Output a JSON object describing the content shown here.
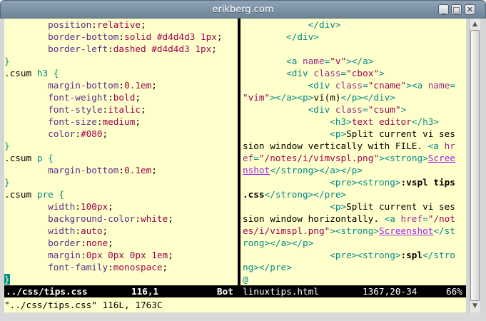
{
  "window": {
    "title": "erikberg.com",
    "buttons": {
      "minimize": "_",
      "maximize": "□",
      "close": "✕"
    }
  },
  "left_pane": {
    "lines": [
      [
        {
          "t": "        "
        },
        {
          "t": "position",
          "c": "prop"
        },
        {
          "t": ":"
        },
        {
          "t": "relative",
          "c": "val"
        },
        {
          "t": ";"
        }
      ],
      [
        {
          "t": "        "
        },
        {
          "t": "border-bottom",
          "c": "prop"
        },
        {
          "t": ":"
        },
        {
          "t": "solid #d4d4d3 1px",
          "c": "val"
        },
        {
          "t": ";"
        }
      ],
      [
        {
          "t": "        "
        },
        {
          "t": "border-left",
          "c": "prop"
        },
        {
          "t": ":"
        },
        {
          "t": "dashed #d4d4d3 1px",
          "c": "val"
        },
        {
          "t": ";"
        }
      ],
      [
        {
          "t": "}",
          "c": "brace"
        }
      ],
      [
        {
          "t": ".csum "
        },
        {
          "t": "h3",
          "c": "sel"
        },
        {
          "t": " "
        },
        {
          "t": "{",
          "c": "brace"
        }
      ],
      [
        {
          "t": "        "
        },
        {
          "t": "margin-bottom",
          "c": "prop"
        },
        {
          "t": ":"
        },
        {
          "t": "0.1em",
          "c": "val"
        },
        {
          "t": ";"
        }
      ],
      [
        {
          "t": "        "
        },
        {
          "t": "font-weight",
          "c": "prop"
        },
        {
          "t": ":"
        },
        {
          "t": "bold",
          "c": "val"
        },
        {
          "t": ";"
        }
      ],
      [
        {
          "t": "        "
        },
        {
          "t": "font-style",
          "c": "prop"
        },
        {
          "t": ":"
        },
        {
          "t": "italic",
          "c": "val"
        },
        {
          "t": ";"
        }
      ],
      [
        {
          "t": "        "
        },
        {
          "t": "font-size",
          "c": "prop"
        },
        {
          "t": ":"
        },
        {
          "t": "medium",
          "c": "val"
        },
        {
          "t": ";"
        }
      ],
      [
        {
          "t": "        "
        },
        {
          "t": "color",
          "c": "prop"
        },
        {
          "t": ":"
        },
        {
          "t": "#080",
          "c": "val"
        },
        {
          "t": ";"
        }
      ],
      [
        {
          "t": "}",
          "c": "brace"
        }
      ],
      [
        {
          "t": ".csum "
        },
        {
          "t": "p",
          "c": "sel"
        },
        {
          "t": " "
        },
        {
          "t": "{",
          "c": "brace"
        }
      ],
      [
        {
          "t": "        "
        },
        {
          "t": "margin-bottom",
          "c": "prop"
        },
        {
          "t": ":"
        },
        {
          "t": "0.1em",
          "c": "val"
        },
        {
          "t": ";"
        }
      ],
      [
        {
          "t": "}",
          "c": "brace"
        }
      ],
      [
        {
          "t": ".csum "
        },
        {
          "t": "pre",
          "c": "sel"
        },
        {
          "t": " "
        },
        {
          "t": "{",
          "c": "brace"
        }
      ],
      [
        {
          "t": "        "
        },
        {
          "t": "width",
          "c": "prop"
        },
        {
          "t": ":"
        },
        {
          "t": "100px",
          "c": "val"
        },
        {
          "t": ";"
        }
      ],
      [
        {
          "t": "        "
        },
        {
          "t": "background-color",
          "c": "prop"
        },
        {
          "t": ":"
        },
        {
          "t": "white",
          "c": "val"
        },
        {
          "t": ";"
        }
      ],
      [
        {
          "t": "        "
        },
        {
          "t": "width",
          "c": "prop"
        },
        {
          "t": ":"
        },
        {
          "t": "auto",
          "c": "val"
        },
        {
          "t": ";"
        }
      ],
      [
        {
          "t": "        "
        },
        {
          "t": "border",
          "c": "prop"
        },
        {
          "t": ":"
        },
        {
          "t": "none",
          "c": "val"
        },
        {
          "t": ";"
        }
      ],
      [
        {
          "t": "        "
        },
        {
          "t": "margin",
          "c": "prop"
        },
        {
          "t": ":"
        },
        {
          "t": "0px 0px 0px 1em",
          "c": "val"
        },
        {
          "t": ";"
        }
      ],
      [
        {
          "t": "        "
        },
        {
          "t": "font-family",
          "c": "prop"
        },
        {
          "t": ":"
        },
        {
          "t": "monospace",
          "c": "val"
        },
        {
          "t": ";"
        }
      ],
      [
        {
          "t": "}",
          "c": "cursor"
        }
      ]
    ]
  },
  "right_pane": {
    "lines": [
      [
        {
          "t": "            "
        },
        {
          "t": "</div>",
          "c": "tag"
        }
      ],
      [
        {
          "t": "        "
        },
        {
          "t": "</div>",
          "c": "tag"
        }
      ],
      [
        {
          "t": ""
        }
      ],
      [
        {
          "t": "        "
        },
        {
          "t": "<a ",
          "c": "tag"
        },
        {
          "t": "name",
          "c": "attr"
        },
        {
          "t": "=",
          "c": "tag"
        },
        {
          "t": "\"v\"",
          "c": "str"
        },
        {
          "t": "></a>",
          "c": "tag"
        }
      ],
      [
        {
          "t": "        "
        },
        {
          "t": "<div ",
          "c": "tag"
        },
        {
          "t": "class",
          "c": "attr"
        },
        {
          "t": "=",
          "c": "tag"
        },
        {
          "t": "\"cbox\"",
          "c": "str"
        },
        {
          "t": ">",
          "c": "tag"
        }
      ],
      [
        {
          "t": "            "
        },
        {
          "t": "<div ",
          "c": "tag"
        },
        {
          "t": "class",
          "c": "attr"
        },
        {
          "t": "=",
          "c": "tag"
        },
        {
          "t": "\"cname\"",
          "c": "str"
        },
        {
          "t": "><a ",
          "c": "tag"
        },
        {
          "t": "name",
          "c": "attr"
        },
        {
          "t": "=",
          "c": "tag"
        }
      ],
      [
        {
          "t": "\"vim\"",
          "c": "str"
        },
        {
          "t": "></a><p>",
          "c": "tag"
        },
        {
          "t": "vi(m)"
        },
        {
          "t": "</p></div>",
          "c": "tag"
        }
      ],
      [
        {
          "t": "            "
        },
        {
          "t": "<div ",
          "c": "tag"
        },
        {
          "t": "class",
          "c": "attr"
        },
        {
          "t": "=",
          "c": "tag"
        },
        {
          "t": "\"csum\"",
          "c": "str"
        },
        {
          "t": ">",
          "c": "tag"
        }
      ],
      [
        {
          "t": "                "
        },
        {
          "t": "<h3>",
          "c": "tag"
        },
        {
          "t": "text editor",
          "c": "str"
        },
        {
          "t": "</h3>",
          "c": "tag"
        }
      ],
      [
        {
          "t": "                "
        },
        {
          "t": "<p>",
          "c": "tag"
        },
        {
          "t": "Split current vi ses"
        }
      ],
      [
        {
          "t": "sion window vertically with FILE. "
        },
        {
          "t": "<a ",
          "c": "tag"
        },
        {
          "t": "hr",
          "c": "attr"
        }
      ],
      [
        {
          "t": "ef",
          "c": "attr"
        },
        {
          "t": "=",
          "c": "tag"
        },
        {
          "t": "\"/notes/i/vimvspl.png\"",
          "c": "str"
        },
        {
          "t": "><strong>",
          "c": "tag"
        },
        {
          "t": "Scree",
          "c": "link"
        }
      ],
      [
        {
          "t": "nshot",
          "c": "link"
        },
        {
          "t": "</strong></a></p>",
          "c": "tag"
        }
      ],
      [
        {
          "t": "                "
        },
        {
          "t": "<pre><strong>",
          "c": "tag"
        },
        {
          "t": ":vspl tips",
          "c": "bold"
        }
      ],
      [
        {
          "t": ".css",
          "c": "bold"
        },
        {
          "t": "</strong></pre>",
          "c": "tag"
        }
      ],
      [
        {
          "t": "                "
        },
        {
          "t": "<p>",
          "c": "tag"
        },
        {
          "t": "Split current vi ses"
        }
      ],
      [
        {
          "t": "sion window horizontally. "
        },
        {
          "t": "<a ",
          "c": "tag"
        },
        {
          "t": "href",
          "c": "attr"
        },
        {
          "t": "=",
          "c": "tag"
        },
        {
          "t": "\"/not",
          "c": "str"
        }
      ],
      [
        {
          "t": "es/i/vimspl.png\"",
          "c": "str"
        },
        {
          "t": "><strong>",
          "c": "tag"
        },
        {
          "t": "Screenshot",
          "c": "link"
        },
        {
          "t": "</st",
          "c": "tag"
        }
      ],
      [
        {
          "t": "rong></a></p>",
          "c": "tag"
        }
      ],
      [
        {
          "t": "                "
        },
        {
          "t": "<pre><strong>",
          "c": "tag"
        },
        {
          "t": ":spl",
          "c": "bold"
        },
        {
          "t": "</stro",
          "c": "tag"
        }
      ],
      [
        {
          "t": "ng></pre>",
          "c": "tag"
        }
      ],
      [
        {
          "t": "@",
          "c": "sel"
        }
      ]
    ]
  },
  "status": {
    "left": {
      "file": "../css/tips.css",
      "position": "116,1",
      "scroll": "Bot"
    },
    "right": {
      "file": "linuxtips.html",
      "position": "1367,20-34",
      "scroll": "66%"
    }
  },
  "cmdline": "\"../css/tips.css\" 116L, 1763C",
  "scrollbar": {
    "up_arrow": "▲",
    "down_arrow": "▼"
  }
}
